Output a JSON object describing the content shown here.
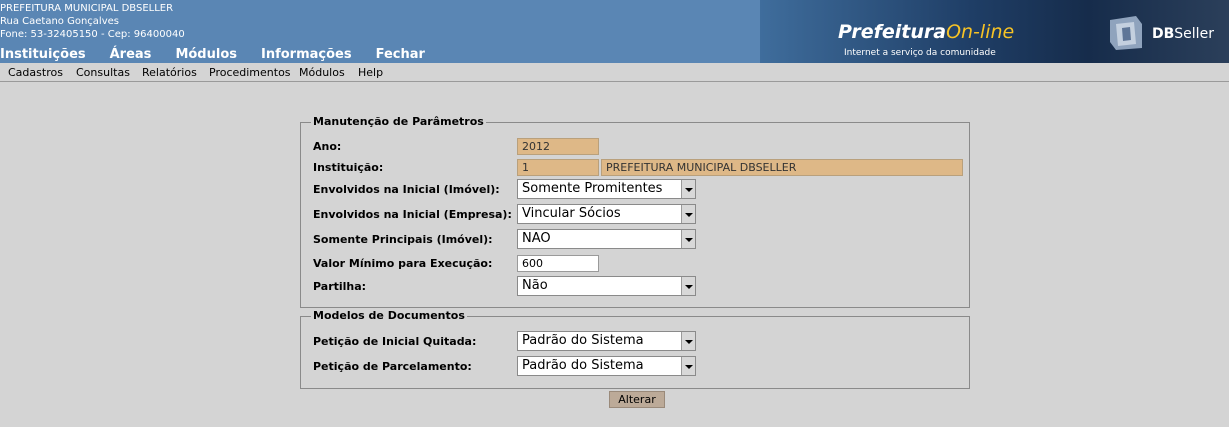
{
  "header": {
    "org_name": "PREFEITURA MUNICIPAL DBSELLER",
    "address": "Rua Caetano Gonçalves",
    "contact": "Fone: 53-32405150  -  Cep: 96400040",
    "menu": [
      "Instituições",
      "Áreas",
      "Módulos",
      "Informações",
      "Fechar"
    ],
    "banner": {
      "prefeitura": "Prefeitura",
      "online": "On-line",
      "tagline": "Internet a serviço da comunidade",
      "brand_db": "DB",
      "brand_seller": "Seller"
    }
  },
  "submenu": [
    "Cadastros",
    "Consultas",
    "Relatórios",
    "Procedimentos",
    "Módulos",
    "Help"
  ],
  "params": {
    "legend": "Manutenção de Parâmetros",
    "ano_label": "Ano:",
    "ano_value": "2012",
    "instituicao_label": "Instituição:",
    "instituicao_code": "1",
    "instituicao_name": "PREFEITURA MUNICIPAL DBSELLER",
    "env_imovel_label": "Envolvidos na Inicial (Imóvel):",
    "env_imovel_value": "Somente Promitentes",
    "env_empresa_label": "Envolvidos na Inicial (Empresa):",
    "env_empresa_value": "Vincular Sócios",
    "principais_label": "Somente Principais (Imóvel):",
    "principais_value": "NAO",
    "valor_min_label": "Valor Mínimo para Execução:",
    "valor_min_value": "600",
    "partilha_label": "Partilha:",
    "partilha_value": "Não"
  },
  "docs": {
    "legend": "Modelos de Documentos",
    "quitada_label": "Petição de Inicial Quitada:",
    "quitada_value": "Padrão do Sistema",
    "parcelamento_label": "Petição de Parcelamento:",
    "parcelamento_value": "Padrão do Sistema"
  },
  "actions": {
    "alterar": "Alterar"
  },
  "colors": {
    "header_bg": "#5a86b4",
    "readonly_bg": "#deb887",
    "page_bg": "#d4d4d4",
    "button_bg": "#bcaa98"
  }
}
